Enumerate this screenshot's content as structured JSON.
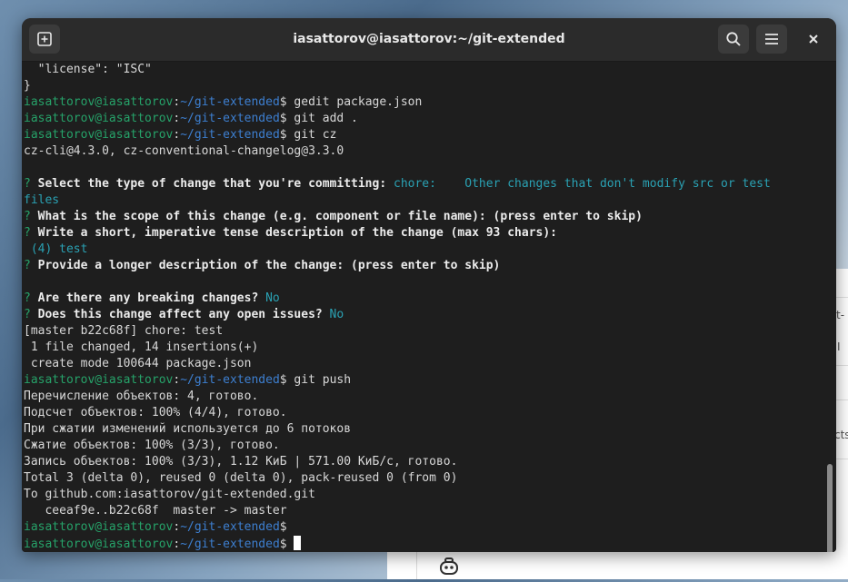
{
  "window": {
    "title": "iasattorov@iasattorov:~/git-extended"
  },
  "icons": {
    "new_tab": "new-tab-icon",
    "search": "search-icon",
    "menu": "hamburger-menu-icon",
    "close": "close-icon"
  },
  "colors": {
    "prompt_user": "#26a269",
    "prompt_path": "#3d7fd0",
    "accent_cyan": "#2aa1b3",
    "terminal_bg": "#1e1e1e"
  },
  "prompt": {
    "user": "iasattorov@iasattorov",
    "sep": ":",
    "path": "~/git-extended",
    "dollar": "$"
  },
  "terminal": {
    "l01": "  \"license\": \"ISC\"",
    "l02": "}",
    "cmd03": " gedit package.json",
    "cmd04": " git add .",
    "cmd05": " git cz",
    "l06": "cz-cli@4.3.0, cz-conventional-changelog@3.3.0",
    "q_mark": "?",
    "q08": " Select the type of change that you're committing:",
    "a08": " chore:    Other changes that don't modify src or test",
    "a08b": "files",
    "q10": " What is the scope of this change (e.g. component or file name): (press enter to skip)",
    "q11": " Write a short, imperative tense description of the change (max 93 chars):",
    "a12": " (4) test",
    "q13": " Provide a longer description of the change: (press enter to skip)",
    "q15": " Are there any breaking changes?",
    "a15": " No",
    "q16": " Does this change affect any open issues?",
    "a16": " No",
    "l17": "[master b22c68f] chore: test",
    "l18": " 1 file changed, 14 insertions(+)",
    "l19": " create mode 100644 package.json",
    "cmd20": " git push",
    "l21": "Перечисление объектов: 4, готово.",
    "l22": "Подсчет объектов: 100% (4/4), готово.",
    "l23": "При сжатии изменений используется до 6 потоков",
    "l24": "Сжатие объектов: 100% (3/3), готово.",
    "l25": "Запись объектов: 100% (3/3), 1.12 КиБ | 571.00 КиБ/с, готово.",
    "l26": "Total 3 (delta 0), reused 0 (delta 0), pack-reused 0 (from 0)",
    "l27": "To github.com:iasattorov/git-extended.git",
    "l28": "   ceeaf9e..b22c68f  master -> master"
  },
  "background": {
    "frag1": "t-",
    "frag2": "I",
    "frag3": "cts"
  }
}
